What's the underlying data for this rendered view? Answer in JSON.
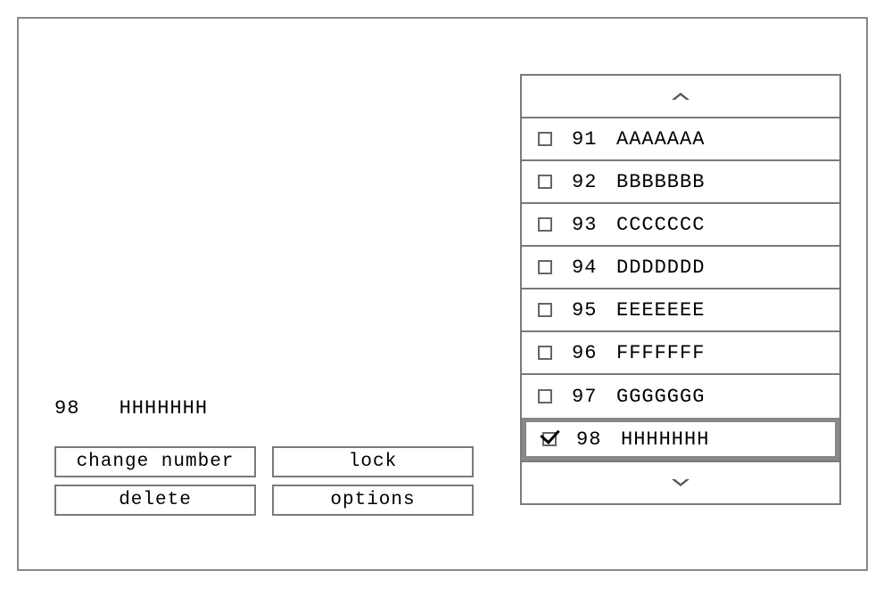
{
  "selected": {
    "number": "98",
    "label": "HHHHHHH"
  },
  "buttons": {
    "change_number": "change number",
    "lock": "lock",
    "delete": "delete",
    "options": "options"
  },
  "list": [
    {
      "number": "91",
      "label": "AAAAAAA",
      "checked": false,
      "selected": false
    },
    {
      "number": "92",
      "label": "BBBBBBB",
      "checked": false,
      "selected": false
    },
    {
      "number": "93",
      "label": "CCCCCCC",
      "checked": false,
      "selected": false
    },
    {
      "number": "94",
      "label": "DDDDDDD",
      "checked": false,
      "selected": false
    },
    {
      "number": "95",
      "label": "EEEEEEE",
      "checked": false,
      "selected": false
    },
    {
      "number": "96",
      "label": "FFFFFFF",
      "checked": false,
      "selected": false
    },
    {
      "number": "97",
      "label": "GGGGGGG",
      "checked": false,
      "selected": false
    },
    {
      "number": "98",
      "label": "HHHHHHH",
      "checked": true,
      "selected": true
    }
  ]
}
